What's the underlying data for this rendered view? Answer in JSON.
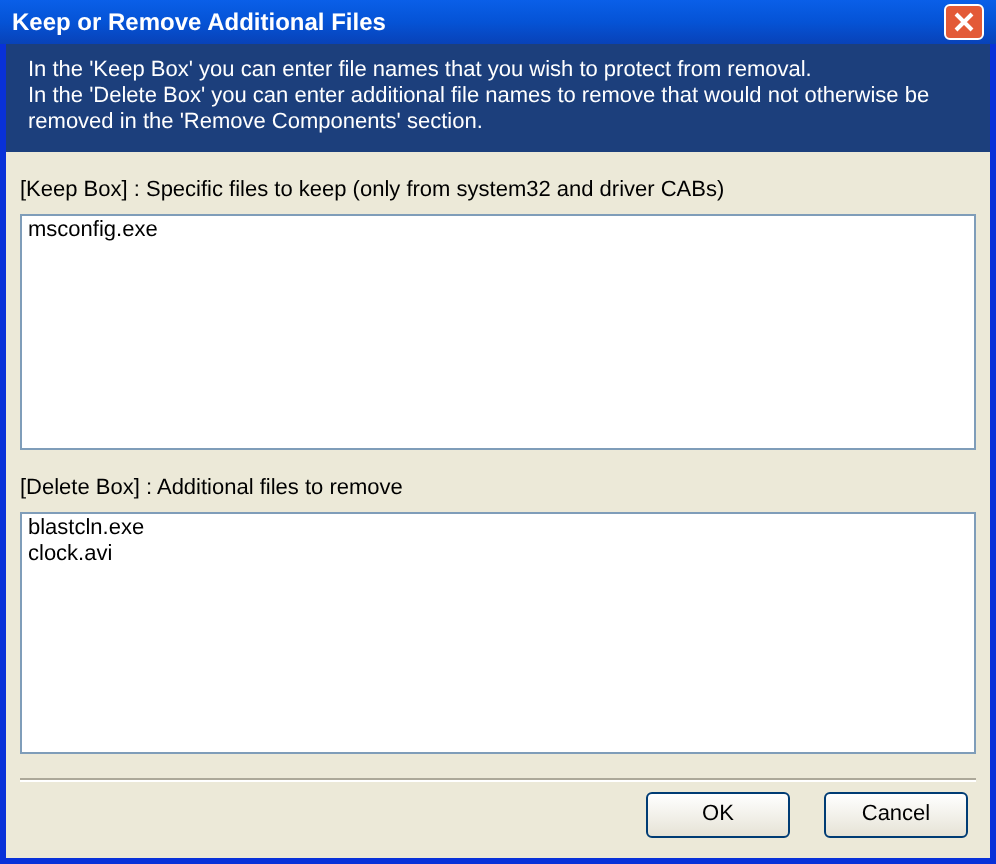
{
  "window": {
    "title": "Keep or Remove Additional Files"
  },
  "header": {
    "lines": [
      "In the 'Keep Box' you can enter file names that you wish to protect from removal.",
      "In the 'Delete Box' you can enter additional file names to remove that would not otherwise be removed in the 'Remove Components' section."
    ]
  },
  "keep_box": {
    "label": "[Keep Box] : Specific files to keep (only from system32 and driver CABs)",
    "value": "msconfig.exe"
  },
  "delete_box": {
    "label": "[Delete Box] : Additional files to remove",
    "value": "blastcln.exe\nclock.avi"
  },
  "buttons": [
    "OK",
    "Cancel"
  ]
}
